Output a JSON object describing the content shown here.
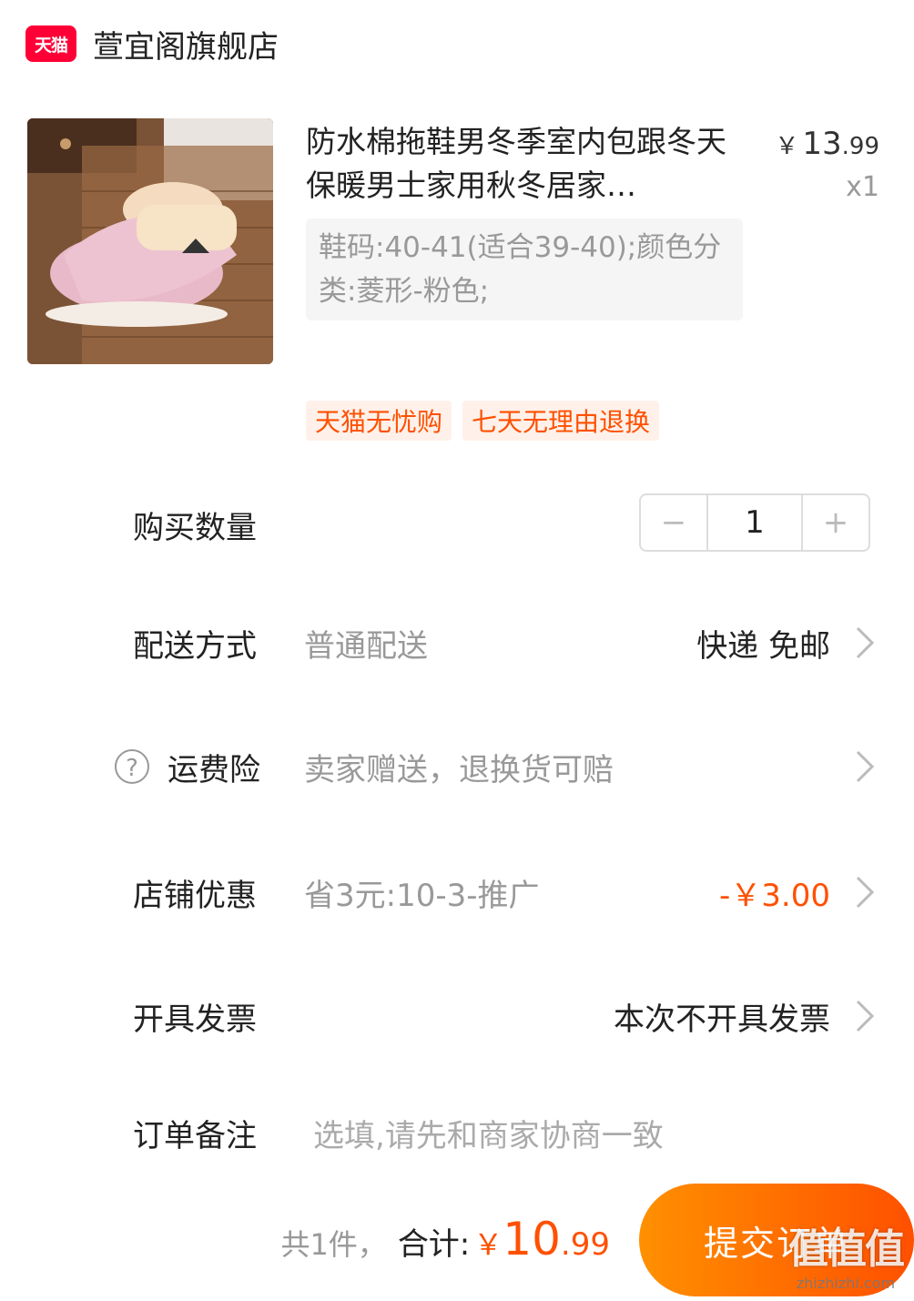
{
  "store": {
    "logo_text": "天猫",
    "name": "萱宜阁旗舰店"
  },
  "product": {
    "image_name": "pink-quilted-slippers",
    "title": "防水棉拖鞋男冬季室内包跟冬天保暖男士家用秋冬居家…",
    "price_symbol": "￥",
    "price_int": "13",
    "price_dec": ".99",
    "quantity_text": "x1",
    "sku": "鞋码:40-41(适合39-40);颜色分类:菱形-粉色;"
  },
  "tags": [
    "天猫无忧购",
    "七天无理由退换"
  ],
  "quantity_row": {
    "label": "购买数量",
    "minus": "−",
    "value": "1",
    "plus": "+"
  },
  "shipping_row": {
    "label": "配送方式",
    "desc": "普通配送",
    "value": "快递 免邮"
  },
  "freight_row": {
    "label": "运费险",
    "help": "?",
    "desc": "卖家赠送，退换货可赔"
  },
  "discount_row": {
    "label": "店铺优惠",
    "desc": "省3元:10-3-推广",
    "value": "-￥3.00"
  },
  "invoice_row": {
    "label": "开具发票",
    "value": "本次不开具发票"
  },
  "note_row": {
    "label": "订单备注",
    "placeholder": "选填,请先和商家协商一致"
  },
  "bottom": {
    "count_text": "共1件，",
    "total_label": "合计:",
    "total_symbol": "￥",
    "total_int": "10",
    "total_dec": ".99",
    "submit_label": "提交订单",
    "watermark_big": "值值值",
    "watermark_small": "zhizhizhi.com"
  },
  "colors": {
    "accent": "#ff5000",
    "brand": "#ff0036",
    "muted": "#999999"
  }
}
